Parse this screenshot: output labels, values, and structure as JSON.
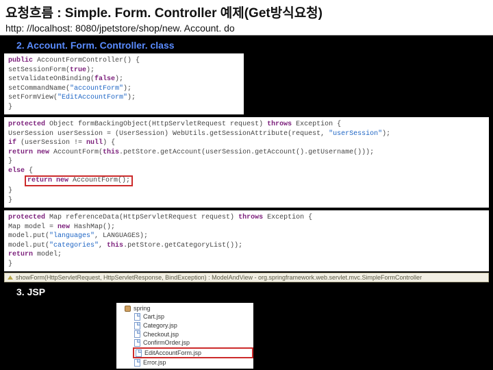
{
  "header": {
    "title": "요청흐름 : Simple. Form. Controller 예제(Get방식요청)",
    "url": "http: //localhost: 8080/jpetstore/shop/new. Account. do"
  },
  "section2": {
    "label": "2. Account. Form. Controller. class",
    "block1": {
      "l1a": "public",
      "l1b": " AccountFormController() {",
      "l2": "  setSessionForm(",
      "l2v": "true",
      "l2e": ");",
      "l3": "  setValidateOnBinding(",
      "l3v": "false",
      "l3e": ");",
      "l4": "  setCommandName(",
      "l4v": "\"accountForm\"",
      "l4e": ");",
      "l5": "  setFormView(",
      "l5v": "\"EditAccountForm\"",
      "l5e": ");",
      "l6": "}"
    },
    "block2": {
      "l1a": "protected",
      "l1b": " Object formBackingObject(HttpServletRequest request) ",
      "l1c": "throws",
      "l1d": " Exception {",
      "l2": "  UserSession userSession = (UserSession) WebUtils.getSessionAttribute(request, ",
      "l2v": "\"userSession\"",
      "l2e": ");",
      "l3a": "  if",
      "l3b": " (userSession != ",
      "l3c": "null",
      "l3d": ") {",
      "l4a": "    return new",
      "l4b": " AccountForm(",
      "l4c": "this",
      "l4d": ".petStore.getAccount(userSession.getAccount().getUsername()));",
      "l5": "  }",
      "l6a": "  else",
      "l6b": " {",
      "l7a": "return new",
      "l7b": " AccountForm();",
      "l8": "  }",
      "l9": "}"
    },
    "block3": {
      "l1a": "protected",
      "l1b": " Map referenceData(HttpServletRequest request) ",
      "l1c": "throws",
      "l1d": " Exception {",
      "l2a": "  Map model = ",
      "l2b": "new",
      "l2c": " HashMap();",
      "l3": "  model.put(",
      "l3v": "\"languages\"",
      "l3e": ", LANGUAGES);",
      "l4": "  model.put(",
      "l4v": "\"categories\"",
      "l4b": ", ",
      "l4c": "this",
      "l4e": ".petStore.getCategoryList());",
      "l5a": "  return",
      "l5b": " model;",
      "l6": "}"
    },
    "inherit": "showForm(HttpServletRequest, HttpServletResponse, BindException) : ModelAndView - org.springframework.web.servlet.mvc.SimpleFormController"
  },
  "section3": {
    "label": "3. JSP",
    "tree": {
      "root": "spring",
      "items": [
        "Cart.jsp",
        "Category.jsp",
        "Checkout.jsp",
        "ConfirmOrder.jsp"
      ],
      "highlight": "EditAccountForm.jsp",
      "after": "Error.jsp"
    }
  }
}
